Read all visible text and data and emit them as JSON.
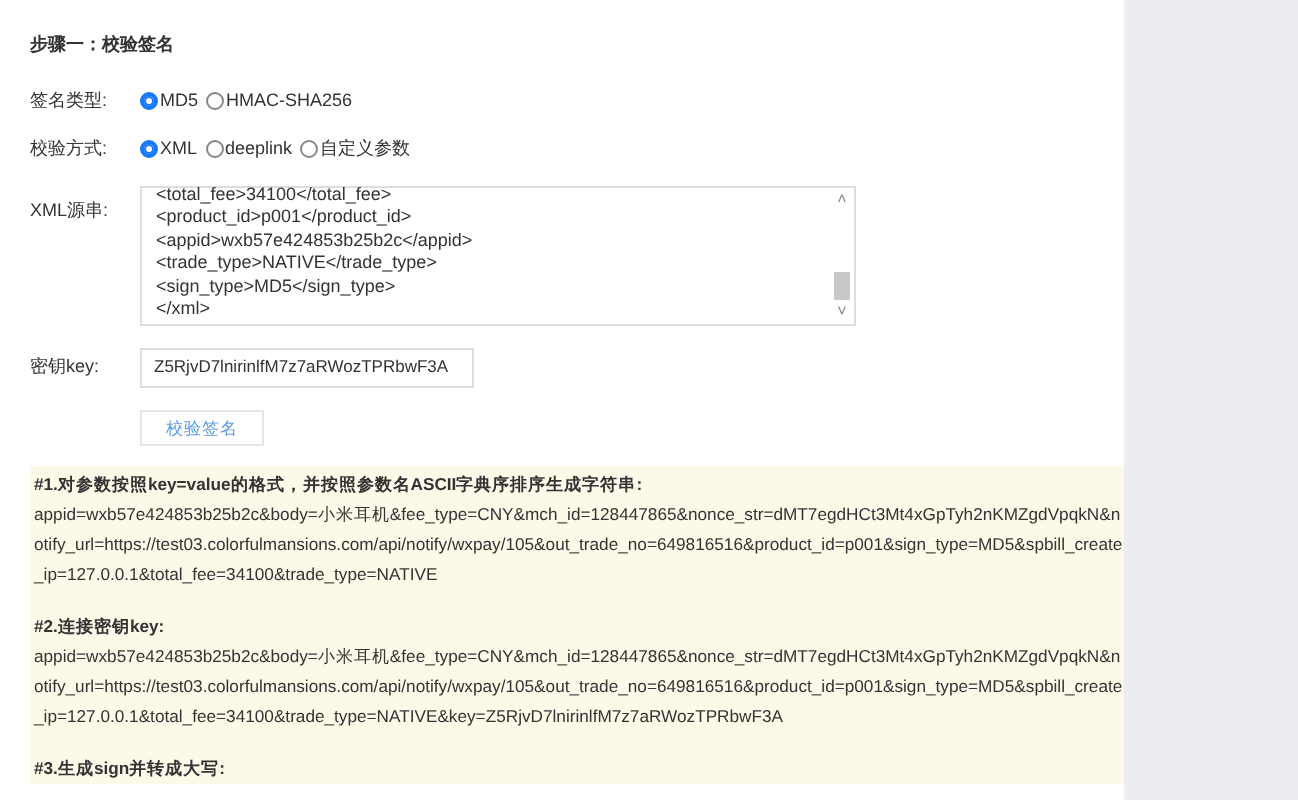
{
  "step_title": "步骤一：校验签名",
  "sign_type": {
    "label": "签名类型:",
    "options": [
      {
        "label": "MD5",
        "selected": true
      },
      {
        "label": "HMAC-SHA256",
        "selected": false
      }
    ]
  },
  "verify_mode": {
    "label": "校验方式:",
    "options": [
      {
        "label": "XML",
        "selected": true
      },
      {
        "label": "deeplink",
        "selected": false
      },
      {
        "label": "自定义参数",
        "selected": false
      }
    ]
  },
  "xml_source": {
    "label": "XML源串:",
    "lines": [
      "<total_fee>34100</total_fee>",
      "<product_id>p001</product_id>",
      "<appid>wxb57e424853b25b2c</appid>",
      "<trade_type>NATIVE</trade_type>",
      "<sign_type>MD5</sign_type>",
      "</xml>"
    ],
    "scroll_up": "˄",
    "scroll_down": "˅"
  },
  "secret_key": {
    "label": "密钥key:",
    "value": "Z5RjvD7lnirinlfM7z7aRWozTPRbwF3A"
  },
  "verify_button": "校验签名",
  "result_sections": [
    {
      "heading": "#1.对参数按照key=value的格式，并按照参数名ASCII字典序排序生成字符串:",
      "body": "appid=wxb57e424853b25b2c&body=小米耳机&fee_type=CNY&mch_id=128447865&nonce_str=dMT7egdHCt3Mt4xGpTyh2nKMZgdVpqkN&notify_url=https://test03.colorfulmansions.com/api/notify/wxpay/105&out_trade_no=649816516&product_id=p001&sign_type=MD5&spbill_create_ip=127.0.0.1&total_fee=34100&trade_type=NATIVE"
    },
    {
      "heading": "#2.连接密钥key:",
      "body": "appid=wxb57e424853b25b2c&body=小米耳机&fee_type=CNY&mch_id=128447865&nonce_str=dMT7egdHCt3Mt4xGpTyh2nKMZgdVpqkN&notify_url=https://test03.colorfulmansions.com/api/notify/wxpay/105&out_trade_no=649816516&product_id=p001&sign_type=MD5&spbill_create_ip=127.0.0.1&total_fee=34100&trade_type=NATIVE&key=Z5RjvD7lnirinlfM7z7aRWozTPRbwF3A"
    },
    {
      "heading": "#3.生成sign并转成大写:"
    }
  ]
}
